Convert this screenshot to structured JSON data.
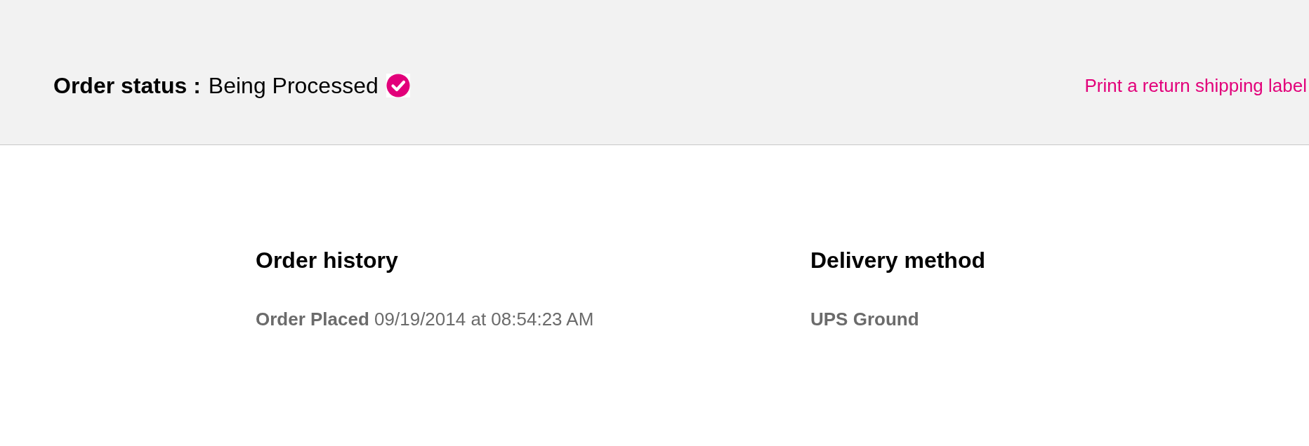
{
  "order_status": {
    "label": "Order status :",
    "value": "Being Processed",
    "verified": true
  },
  "return_link": "Print a return shipping label",
  "sections": [
    {
      "heading": "Order history",
      "lines": [
        {
          "kind": "event",
          "text": "**Order Placed** 09/19/2014 at 08:54:23 AM"
        }
      ]
    },
    {
      "heading": "Delivery method",
      "lines": [
        {
          "kind": "method",
          "text": "UPS Ground"
        }
      ]
    }
  ]
}
